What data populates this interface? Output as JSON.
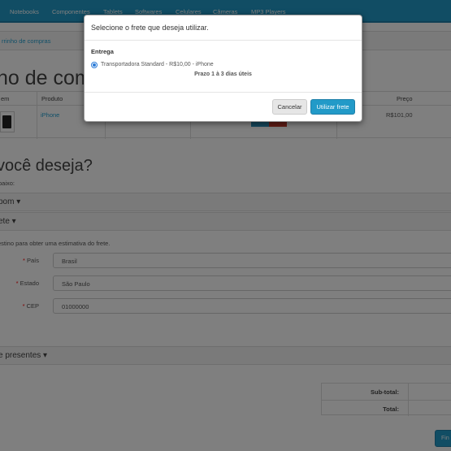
{
  "nav": {
    "items": [
      "Notebooks",
      "Componentes",
      "Tablets",
      "Softwares",
      "Celulares",
      "Câmeras",
      "MP3 Players"
    ]
  },
  "breadcrumb": {
    "text": "rrinho de compras"
  },
  "page": {
    "title": "ho de comp"
  },
  "cart": {
    "columns": [
      "em",
      "Produto",
      "Preço"
    ],
    "product_name": "iPhone",
    "price": "R$101,00"
  },
  "next": {
    "heading": "você deseja?",
    "subtext": "baixo:"
  },
  "panels": {
    "coupon": "pom ▾",
    "shipping": "ete ▾",
    "gifts": "e presentes ▾"
  },
  "shipping_form": {
    "description": "estino para obter uma estimativa do frete.",
    "country_label": "País",
    "country_value": "Brasil",
    "state_label": "Estado",
    "state_value": "São Paulo",
    "zip_label": "CEP",
    "zip_value": "01000000"
  },
  "totals": {
    "subtotal_label": "Sub-total:",
    "total_label": "Total:"
  },
  "checkout": {
    "label": "Fin"
  },
  "modal": {
    "title": "Selecione o frete que deseja utilizar.",
    "section": "Entrega",
    "option_label": "Transportadora Standard - R$10,00 - iPhone",
    "option_sub": "Prazo 1 à 3 dias úteis",
    "cancel_label": "Cancelar",
    "confirm_label": "Utilizar frete"
  },
  "colors": {
    "brand": "#229ac8",
    "link": "#23a1d1",
    "required": "#ff0000"
  }
}
